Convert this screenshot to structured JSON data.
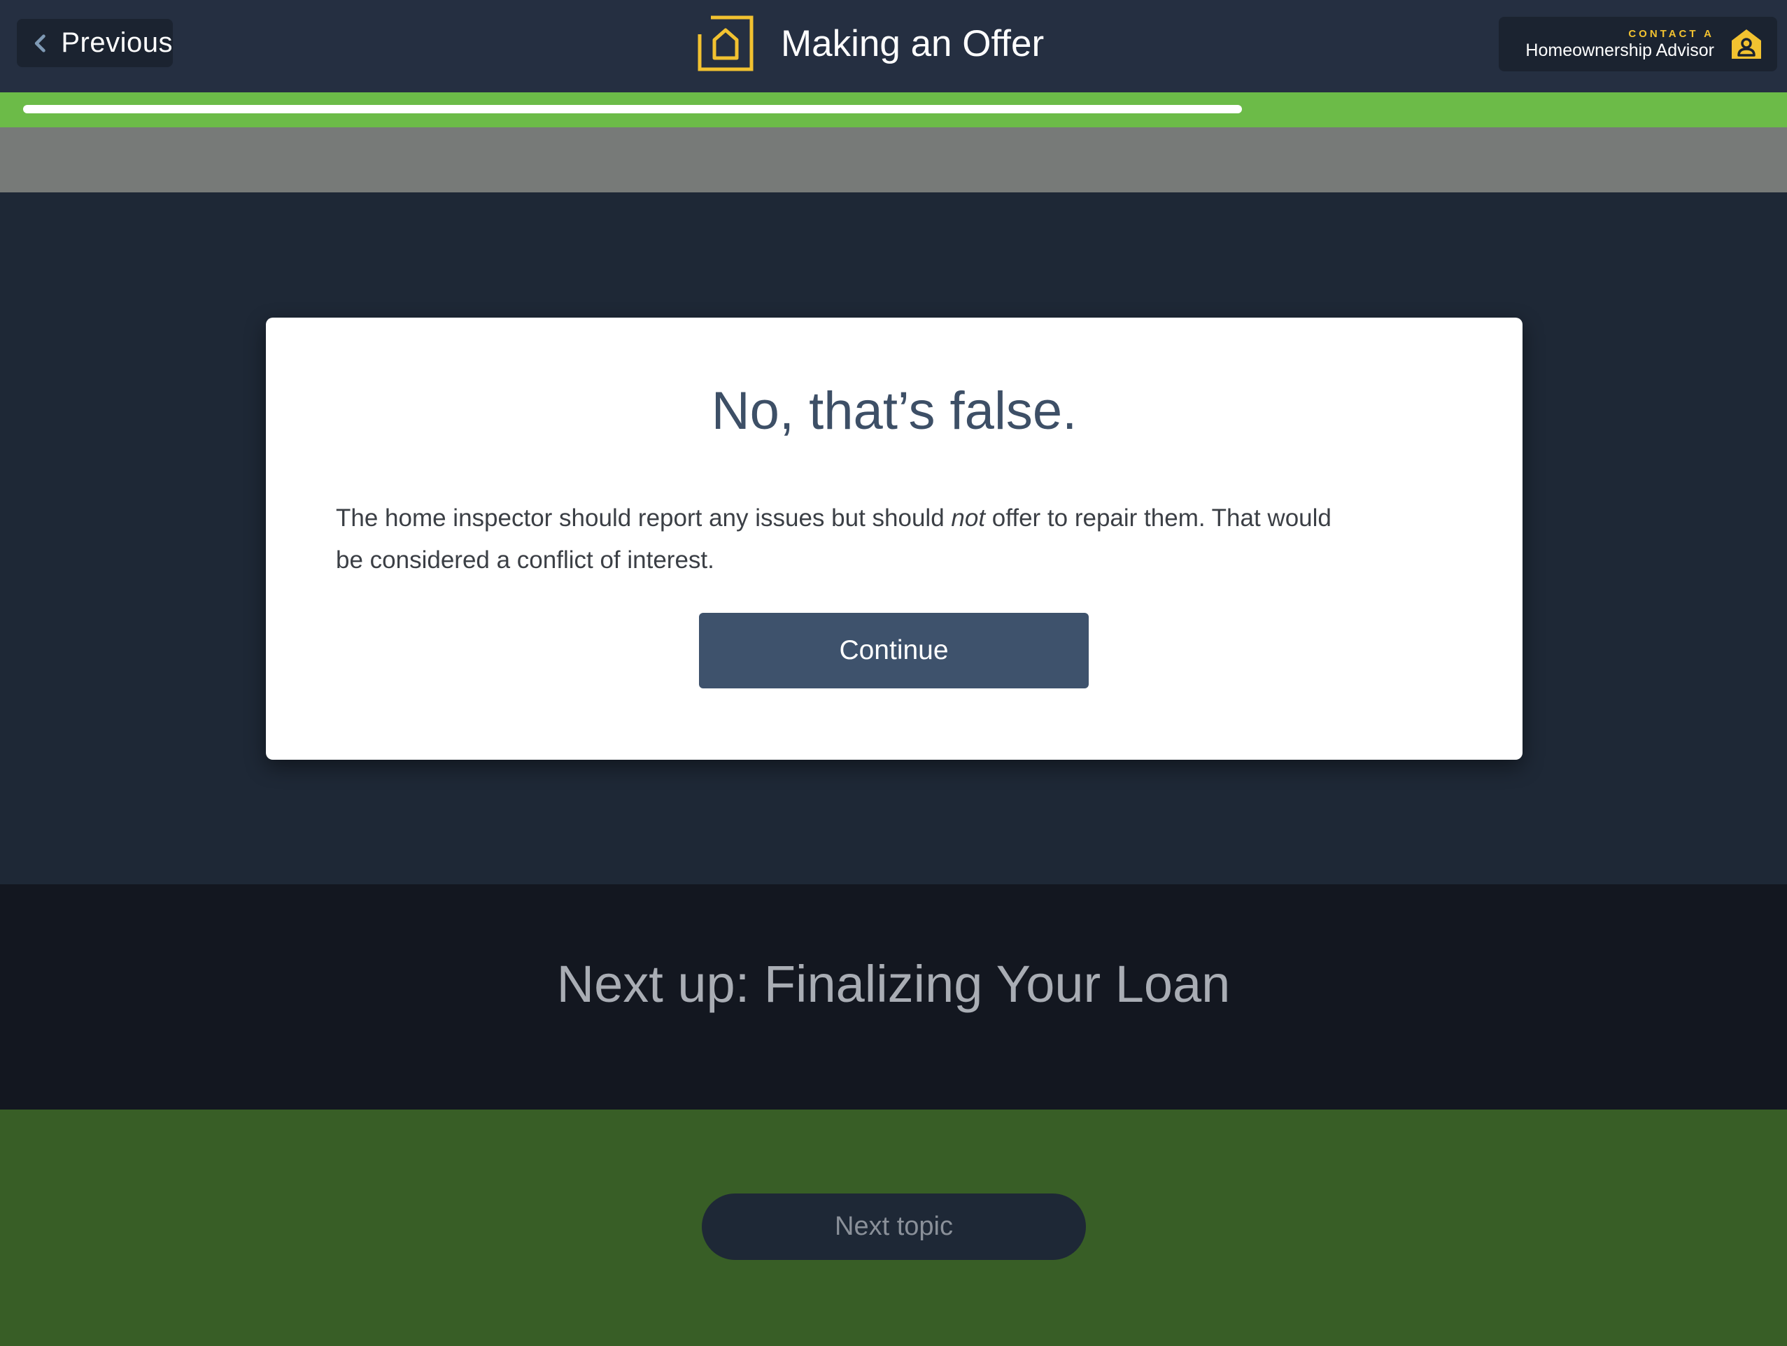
{
  "header": {
    "previous_label": "Previous",
    "title": "Making an Offer",
    "advisor_kicker": "CONTACT A",
    "advisor_name": "Homeownership Advisor"
  },
  "progress": {
    "fraction": 0.7
  },
  "card": {
    "heading": "No, that’s false.",
    "body_before": "The home inspector should report any issues but should ",
    "body_emphasis": "not",
    "body_after": " offer to repair them. That would be considered a conflict of interest.",
    "continue_label": "Continue"
  },
  "next": {
    "label": "Next up: Finalizing Your Loan",
    "button_label": "Next topic"
  },
  "colors": {
    "accent": "#f2c230",
    "progress_green": "#6cbb48",
    "button": "#3e526c",
    "footer_green": "#385e26"
  },
  "icons": [
    "chevron-left-icon",
    "house-logo-icon",
    "advisor-person-icon"
  ]
}
